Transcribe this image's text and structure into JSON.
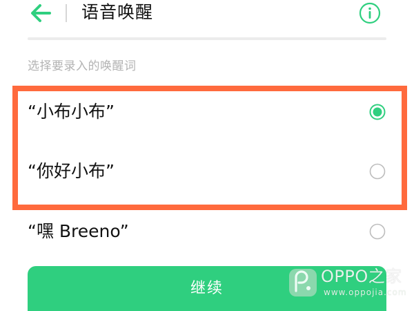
{
  "header": {
    "title": "语音唤醒",
    "back_icon": "arrow-left-icon",
    "info_icon": "info-circle-icon"
  },
  "section": {
    "hint": "选择要录入的唤醒词"
  },
  "options": [
    {
      "label": "“小布小布”",
      "selected": true
    },
    {
      "label": "“你好小布”",
      "selected": false
    },
    {
      "label": "“嘿 Breeno”",
      "selected": false
    }
  ],
  "footer": {
    "continue_label": "继续"
  },
  "watermark": {
    "name": "OPPO之家",
    "url": "www.oppojia.com"
  },
  "colors": {
    "accent": "#2fcf7f",
    "highlight": "#ff6a3d",
    "radio_off": "#bdbdbd"
  }
}
